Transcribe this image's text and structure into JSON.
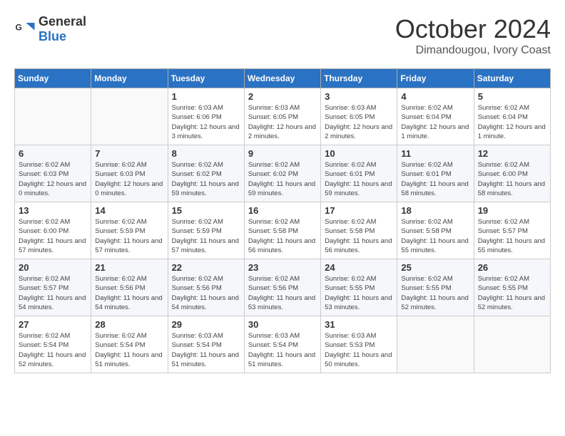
{
  "logo": {
    "line1": "General",
    "line2": "Blue"
  },
  "title": "October 2024",
  "subtitle": "Dimandougou, Ivory Coast",
  "weekdays": [
    "Sunday",
    "Monday",
    "Tuesday",
    "Wednesday",
    "Thursday",
    "Friday",
    "Saturday"
  ],
  "weeks": [
    [
      null,
      null,
      {
        "day": "1",
        "sunrise": "6:03 AM",
        "sunset": "6:06 PM",
        "daylight": "12 hours and 3 minutes."
      },
      {
        "day": "2",
        "sunrise": "6:03 AM",
        "sunset": "6:05 PM",
        "daylight": "12 hours and 2 minutes."
      },
      {
        "day": "3",
        "sunrise": "6:03 AM",
        "sunset": "6:05 PM",
        "daylight": "12 hours and 2 minutes."
      },
      {
        "day": "4",
        "sunrise": "6:02 AM",
        "sunset": "6:04 PM",
        "daylight": "12 hours and 1 minute."
      },
      {
        "day": "5",
        "sunrise": "6:02 AM",
        "sunset": "6:04 PM",
        "daylight": "12 hours and 1 minute."
      }
    ],
    [
      {
        "day": "6",
        "sunrise": "6:02 AM",
        "sunset": "6:03 PM",
        "daylight": "12 hours and 0 minutes."
      },
      {
        "day": "7",
        "sunrise": "6:02 AM",
        "sunset": "6:03 PM",
        "daylight": "12 hours and 0 minutes."
      },
      {
        "day": "8",
        "sunrise": "6:02 AM",
        "sunset": "6:02 PM",
        "daylight": "11 hours and 59 minutes."
      },
      {
        "day": "9",
        "sunrise": "6:02 AM",
        "sunset": "6:02 PM",
        "daylight": "11 hours and 59 minutes."
      },
      {
        "day": "10",
        "sunrise": "6:02 AM",
        "sunset": "6:01 PM",
        "daylight": "11 hours and 59 minutes."
      },
      {
        "day": "11",
        "sunrise": "6:02 AM",
        "sunset": "6:01 PM",
        "daylight": "11 hours and 58 minutes."
      },
      {
        "day": "12",
        "sunrise": "6:02 AM",
        "sunset": "6:00 PM",
        "daylight": "11 hours and 58 minutes."
      }
    ],
    [
      {
        "day": "13",
        "sunrise": "6:02 AM",
        "sunset": "6:00 PM",
        "daylight": "11 hours and 57 minutes."
      },
      {
        "day": "14",
        "sunrise": "6:02 AM",
        "sunset": "5:59 PM",
        "daylight": "11 hours and 57 minutes."
      },
      {
        "day": "15",
        "sunrise": "6:02 AM",
        "sunset": "5:59 PM",
        "daylight": "11 hours and 57 minutes."
      },
      {
        "day": "16",
        "sunrise": "6:02 AM",
        "sunset": "5:58 PM",
        "daylight": "11 hours and 56 minutes."
      },
      {
        "day": "17",
        "sunrise": "6:02 AM",
        "sunset": "5:58 PM",
        "daylight": "11 hours and 56 minutes."
      },
      {
        "day": "18",
        "sunrise": "6:02 AM",
        "sunset": "5:58 PM",
        "daylight": "11 hours and 55 minutes."
      },
      {
        "day": "19",
        "sunrise": "6:02 AM",
        "sunset": "5:57 PM",
        "daylight": "11 hours and 55 minutes."
      }
    ],
    [
      {
        "day": "20",
        "sunrise": "6:02 AM",
        "sunset": "5:57 PM",
        "daylight": "11 hours and 54 minutes."
      },
      {
        "day": "21",
        "sunrise": "6:02 AM",
        "sunset": "5:56 PM",
        "daylight": "11 hours and 54 minutes."
      },
      {
        "day": "22",
        "sunrise": "6:02 AM",
        "sunset": "5:56 PM",
        "daylight": "11 hours and 54 minutes."
      },
      {
        "day": "23",
        "sunrise": "6:02 AM",
        "sunset": "5:56 PM",
        "daylight": "11 hours and 53 minutes."
      },
      {
        "day": "24",
        "sunrise": "6:02 AM",
        "sunset": "5:55 PM",
        "daylight": "11 hours and 53 minutes."
      },
      {
        "day": "25",
        "sunrise": "6:02 AM",
        "sunset": "5:55 PM",
        "daylight": "11 hours and 52 minutes."
      },
      {
        "day": "26",
        "sunrise": "6:02 AM",
        "sunset": "5:55 PM",
        "daylight": "11 hours and 52 minutes."
      }
    ],
    [
      {
        "day": "27",
        "sunrise": "6:02 AM",
        "sunset": "5:54 PM",
        "daylight": "11 hours and 52 minutes."
      },
      {
        "day": "28",
        "sunrise": "6:02 AM",
        "sunset": "5:54 PM",
        "daylight": "11 hours and 51 minutes."
      },
      {
        "day": "29",
        "sunrise": "6:03 AM",
        "sunset": "5:54 PM",
        "daylight": "11 hours and 51 minutes."
      },
      {
        "day": "30",
        "sunrise": "6:03 AM",
        "sunset": "5:54 PM",
        "daylight": "11 hours and 51 minutes."
      },
      {
        "day": "31",
        "sunrise": "6:03 AM",
        "sunset": "5:53 PM",
        "daylight": "11 hours and 50 minutes."
      },
      null,
      null
    ]
  ],
  "labels": {
    "sunrise": "Sunrise:",
    "sunset": "Sunset:",
    "daylight": "Daylight:"
  }
}
